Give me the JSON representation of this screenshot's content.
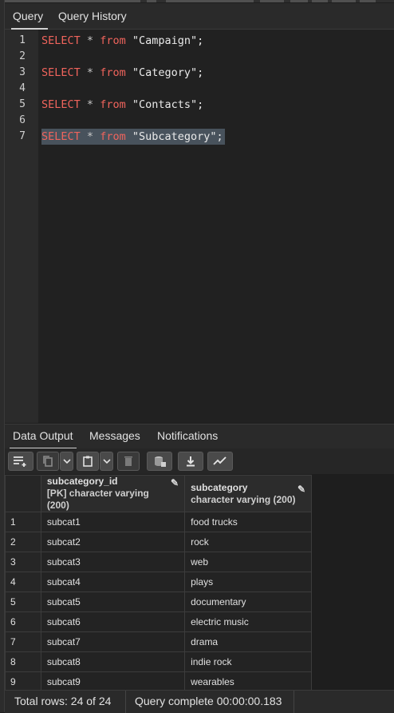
{
  "editor_tabs": [
    "Query",
    "Query History"
  ],
  "code_lines": [
    {
      "n": "1",
      "kw": "SELECT",
      "op": "*",
      "kw2": "from",
      "str": "\"Campaign\";"
    },
    {
      "n": "2"
    },
    {
      "n": "3",
      "kw": "SELECT",
      "op": "*",
      "kw2": "from",
      "str": "\"Category\";"
    },
    {
      "n": "4"
    },
    {
      "n": "5",
      "kw": "SELECT",
      "op": "*",
      "kw2": "from",
      "str": "\"Contacts\";"
    },
    {
      "n": "6"
    },
    {
      "n": "7",
      "kw": "SELECT",
      "op": "*",
      "kw2": "from",
      "str": "\"Subcategory\";"
    }
  ],
  "result_tabs": [
    "Data Output",
    "Messages",
    "Notifications"
  ],
  "toolbar_icons": [
    "add-row-icon",
    "copy-icon",
    "copy-dropdown-icon",
    "paste-icon",
    "paste-dropdown-icon",
    "delete-icon",
    "save-data-icon",
    "download-icon",
    "graph-icon"
  ],
  "columns": [
    {
      "name": "subcategory_id",
      "type": "[PK] character varying (200)"
    },
    {
      "name": "subcategory",
      "type": "character varying (200)"
    }
  ],
  "rows": [
    {
      "n": "1",
      "id": "subcat1",
      "sub": "food trucks"
    },
    {
      "n": "2",
      "id": "subcat2",
      "sub": "rock"
    },
    {
      "n": "3",
      "id": "subcat3",
      "sub": "web"
    },
    {
      "n": "4",
      "id": "subcat4",
      "sub": "plays"
    },
    {
      "n": "5",
      "id": "subcat5",
      "sub": "documentary"
    },
    {
      "n": "6",
      "id": "subcat6",
      "sub": "electric music"
    },
    {
      "n": "7",
      "id": "subcat7",
      "sub": "drama"
    },
    {
      "n": "8",
      "id": "subcat8",
      "sub": "indie rock"
    },
    {
      "n": "9",
      "id": "subcat9",
      "sub": "wearables"
    }
  ],
  "status": {
    "total_rows": "Total rows: 24 of 24",
    "query_complete": "Query complete 00:00:00.183"
  },
  "colors": {
    "keyword": "#f0645c",
    "selection": "#48525c",
    "background": "#1e1e1e"
  }
}
